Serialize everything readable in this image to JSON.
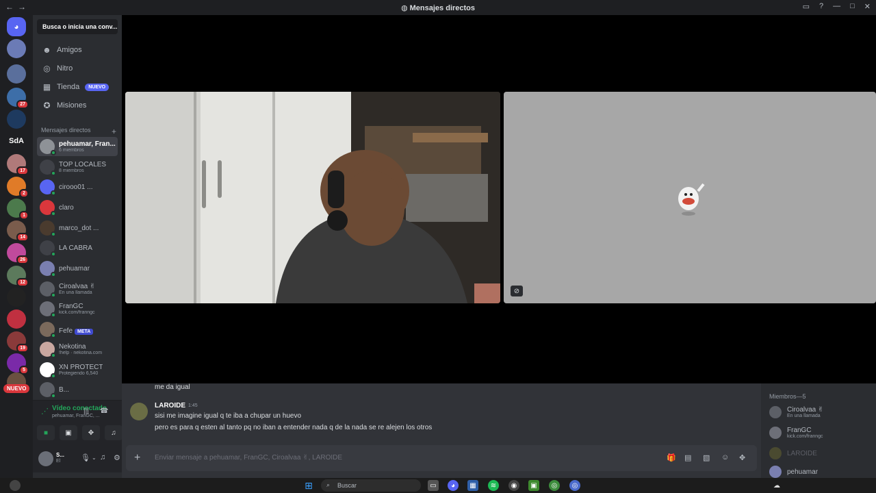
{
  "window": {
    "title": "Mensajes directos",
    "back": "←",
    "forward": "→"
  },
  "sidebar_guilds": {
    "badges": [
      "27",
      "17",
      "2",
      "1",
      "14",
      "26",
      "12",
      "19",
      "5"
    ],
    "sda_label": "SdA",
    "nuevo": "NUEVO"
  },
  "channels": {
    "search_placeholder": "Busca o inicia una conv...",
    "nav": [
      {
        "label": "Amigos"
      },
      {
        "label": "Nitro"
      },
      {
        "label": "Tienda",
        "chip": "NUEVO"
      },
      {
        "label": "Misiones"
      }
    ],
    "dm_header": "Mensajes directos",
    "dm_add": "+",
    "dms": [
      {
        "name": "pehuamar, Fran...",
        "sub": "6 miembros",
        "color": "#8e9297"
      },
      {
        "name": "TOP LOCALES",
        "sub": "8 miembros",
        "color": "#3f4147"
      },
      {
        "name": "cirooo01 ...",
        "sub": "",
        "color": "#5865f2"
      },
      {
        "name": "claro",
        "sub": "",
        "color": "#da373c"
      },
      {
        "name": "marco_dot ...",
        "sub": "",
        "color": "#4a3b2e"
      },
      {
        "name": "LA CABRA",
        "sub": "",
        "color": "#3f4147"
      },
      {
        "name": "pehuamar",
        "sub": "",
        "color": "#7a7fb0"
      },
      {
        "name": "Ciroalvaa ✌",
        "sub": "En una llamada",
        "color": "#5c5f66"
      },
      {
        "name": "FranGC",
        "sub": "kick.com/franngc",
        "color": "#6d6f78"
      },
      {
        "name": "Fefe",
        "sub": "",
        "chip": "META",
        "color": "#7b6a5c"
      },
      {
        "name": "Nekotina",
        "sub": "!help · nekotina.com",
        "color": "#c9a7a0"
      },
      {
        "name": "XN PROTECT",
        "sub": "Protegiendo 6,540",
        "color": "#ffffff"
      },
      {
        "name": "B...",
        "sub": "",
        "color": "#5c5f66"
      }
    ]
  },
  "voice": {
    "status": "Vídeo conectado",
    "channel": "pehuamar, FranGC, ..."
  },
  "user": {
    "name": "S...",
    "status": "El"
  },
  "chat": {
    "prev_message": "me da igual",
    "author": "LAROIDE",
    "time": "1:45",
    "lines": [
      "sisi me imagine igual q te iba a chupar un huevo",
      "pero es para q esten al tanto pq no iban a entender nada q de la nada se re alejen los otros"
    ],
    "composer_placeholder": "Enviar mensaje a pehuamar, FranGC, Ciroalvaa ✌, LAROIDE"
  },
  "members": {
    "header": "Miembros—5",
    "list": [
      {
        "name": "Ciroalvaa ✌",
        "sub": "En una llamada",
        "color": "#5c5f66",
        "offline": false
      },
      {
        "name": "FranGC",
        "sub": "kick.com/franngc",
        "color": "#6d6f78",
        "offline": false
      },
      {
        "name": "LAROIDE",
        "sub": "",
        "color": "#4a4a30",
        "offline": true
      },
      {
        "name": "pehuamar",
        "sub": "",
        "color": "#7a7fb0",
        "offline": false
      }
    ]
  },
  "taskbar": {
    "search_label": "Buscar"
  }
}
